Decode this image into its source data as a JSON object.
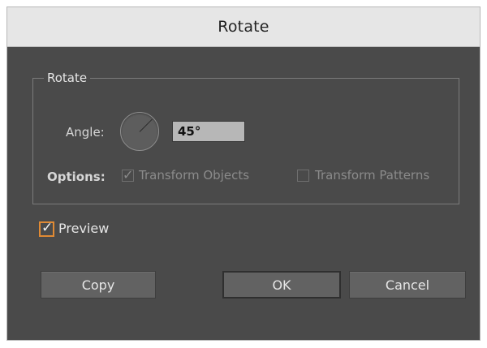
{
  "dialog": {
    "title": "Rotate",
    "group_title": "Rotate",
    "angle_label": "Angle:",
    "angle_value": "45°",
    "options_label": "Options:",
    "options": [
      {
        "label": "Transform Objects",
        "checked": true
      },
      {
        "label": "Transform Patterns",
        "checked": false
      }
    ],
    "preview": {
      "label": "Preview",
      "checked": true
    },
    "buttons": {
      "copy": "Copy",
      "ok": "OK",
      "cancel": "Cancel"
    },
    "colors": {
      "panel_bg": "#4a4a4a",
      "titlebar_bg": "#e6e6e6",
      "accent_checkbox": "#e08a34",
      "input_bg": "#b7b7b7"
    }
  }
}
